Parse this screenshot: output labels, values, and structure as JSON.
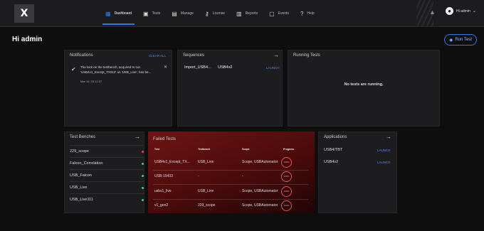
{
  "logo": {
    "text": "X"
  },
  "nav": [
    {
      "icon": "▦",
      "label": "Dashboard"
    },
    {
      "icon": "▣",
      "label": "Tests"
    },
    {
      "icon": "▤",
      "label": "Manage"
    },
    {
      "icon": "⚷",
      "label": "License"
    },
    {
      "icon": "▥",
      "label": "Reports"
    },
    {
      "icon": "▢",
      "label": "Events"
    },
    {
      "icon": "?",
      "label": "Help"
    }
  ],
  "user": {
    "label": "Hi admin"
  },
  "page": {
    "greeting": "Hi admin",
    "run_label": "Run Test"
  },
  "notifications": {
    "title": "Notifications",
    "clear_label": "CLEAR ALL",
    "item": {
      "text": "The lock on the testbench, acquired to run 'USB4v1_Except_TX012' on 'USB_Live', has be...",
      "time": "Mar 16, 03:12:37"
    }
  },
  "sequences": {
    "title": "Sequences",
    "items": [
      "Import_USB4...",
      "USB4v2"
    ],
    "launch_label": "LAUNCH"
  },
  "running": {
    "title": "Running Tests",
    "empty": "No tests are running."
  },
  "benches": {
    "title": "Test Benches",
    "items": [
      {
        "name": "229_scope",
        "status_color": "#e0454b"
      },
      {
        "name": "Falcon_Correlation",
        "status_color": "#3ecf6e"
      },
      {
        "name": "USB_Falcon",
        "status_color": "#3ecf6e"
      },
      {
        "name": "USB_Live",
        "status_color": "#3ecf6e"
      },
      {
        "name": "USB_Live111",
        "status_color": "#3ecf6e"
      }
    ]
  },
  "failed": {
    "title": "Failed Tests",
    "headers": [
      "Test",
      "Testbench",
      "Scope",
      "Progress"
    ],
    "rows": [
      {
        "test": "USB4v1_Except_TX...",
        "bench": "USB_Live",
        "scope": "Scope, USBAutomator",
        "progress": "100%"
      },
      {
        "test": "USB-15433",
        "bench": "-",
        "scope": "-",
        "progress": "100%"
      },
      {
        "test": "usbv1_live",
        "bench": "USB_Live",
        "scope": "Scope, USBAutomator",
        "progress": "100%"
      },
      {
        "test": "v1_gen2",
        "bench": "229_scope",
        "scope": "Scope, USBAutomator",
        "progress": "100%"
      }
    ]
  },
  "applications": {
    "title": "Applications",
    "items": [
      {
        "name": "USB4/TBT",
        "launch": "LAUNCH"
      },
      {
        "name": "USB4v2",
        "launch": "LAUNCH"
      }
    ]
  },
  "colors": {
    "accent": "#2c7be5",
    "failed_bg": "#6e1414"
  }
}
